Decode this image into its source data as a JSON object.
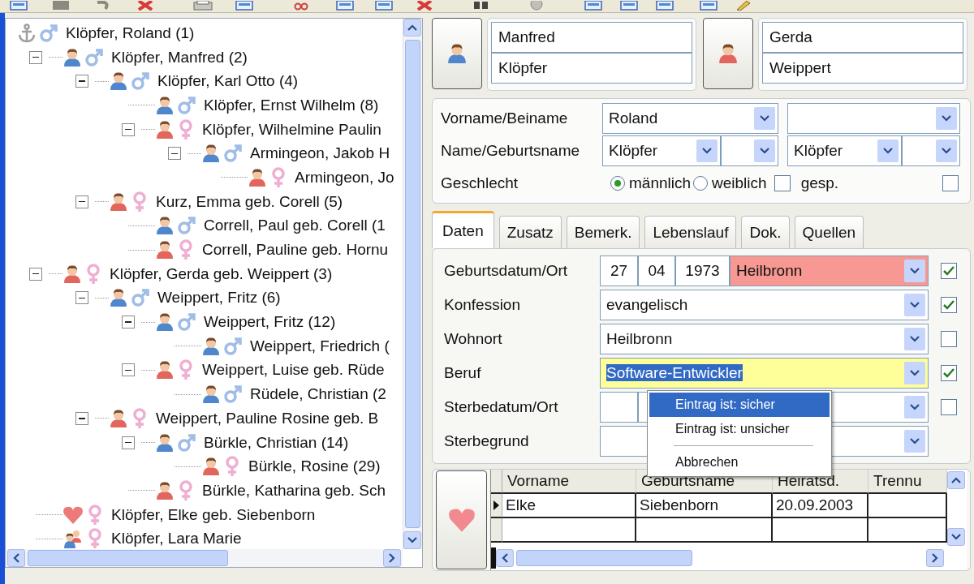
{
  "tree": {
    "nodes": [
      {
        "name": "Klöpfer, Roland (1)",
        "female": false,
        "kind": "anchor",
        "children": [
          {
            "name": "Klöpfer, Manfred (2)",
            "female": false,
            "kind": "person",
            "children": [
              {
                "name": "Klöpfer, Karl Otto (4)",
                "female": false,
                "kind": "person",
                "children": [
                  {
                    "name": "Klöpfer, Ernst Wilhelm (8)",
                    "female": false,
                    "kind": "person"
                  },
                  {
                    "name": "Klöpfer, Wilhelmine Paulin",
                    "female": true,
                    "kind": "person",
                    "children": [
                      {
                        "name": "Armingeon, Jakob H",
                        "female": false,
                        "kind": "person",
                        "children": [
                          {
                            "name": "Armingeon, Jo",
                            "female": true,
                            "kind": "person"
                          }
                        ]
                      }
                    ]
                  }
                ]
              },
              {
                "name": "Kurz, Emma geb. Corell (5)",
                "female": true,
                "kind": "person",
                "children": [
                  {
                    "name": "Correll, Paul geb. Corell (1",
                    "female": false,
                    "kind": "person"
                  },
                  {
                    "name": "Correll, Pauline geb. Hornu",
                    "female": true,
                    "kind": "person"
                  }
                ]
              }
            ]
          },
          {
            "name": "Klöpfer, Gerda geb. Weippert (3)",
            "female": true,
            "kind": "person",
            "children": [
              {
                "name": "Weippert, Fritz (6)",
                "female": false,
                "kind": "person",
                "children": [
                  {
                    "name": "Weippert, Fritz (12)",
                    "female": false,
                    "kind": "person",
                    "children": [
                      {
                        "name": "Weippert, Friedrich (",
                        "female": false,
                        "kind": "person"
                      }
                    ]
                  },
                  {
                    "name": "Weippert, Luise geb. Rüde",
                    "female": true,
                    "kind": "person",
                    "children": [
                      {
                        "name": "Rüdele, Christian (2",
                        "female": false,
                        "kind": "person"
                      }
                    ]
                  }
                ]
              },
              {
                "name": "Weippert, Pauline Rosine geb. B",
                "female": true,
                "kind": "person",
                "children": [
                  {
                    "name": "Bürkle, Christian (14)",
                    "female": false,
                    "kind": "person",
                    "children": [
                      {
                        "name": "Bürkle, Rosine (29)",
                        "female": true,
                        "kind": "person"
                      }
                    ]
                  },
                  {
                    "name": "Bürkle, Katharina geb. Sch",
                    "female": true,
                    "kind": "person"
                  }
                ]
              }
            ]
          },
          {
            "name": "Klöpfer, Elke geb. Siebenborn",
            "female": true,
            "kind": "heart"
          },
          {
            "name": "Klöpfer, Lara Marie",
            "female": true,
            "kind": "child"
          }
        ]
      }
    ]
  },
  "parents": [
    {
      "first": "Manfred",
      "last": "Klöpfer",
      "female": false
    },
    {
      "first": "Gerda",
      "last": "Weippert",
      "female": true
    }
  ],
  "name_fields": {
    "first_name_label": "Vorname/Beiname",
    "first_name": "Roland",
    "last_name_label": "Name/Geburtsname",
    "last_name": "Klöpfer",
    "birth_name": "Klöpfer",
    "sex_label": "Geschlecht",
    "sex_options": [
      {
        "label": "männlich",
        "selected": true
      },
      {
        "label": "weiblich",
        "selected": false
      }
    ],
    "locked": {
      "label": "gesp.",
      "checked": false
    },
    "extra_checked": false
  },
  "tabs": [
    {
      "label": "Daten",
      "selected": true
    },
    {
      "label": "Zusatz",
      "selected": false
    },
    {
      "label": "Bemerk.",
      "selected": false
    },
    {
      "label": "Lebenslauf",
      "selected": false
    },
    {
      "label": "Dok.",
      "selected": false
    },
    {
      "label": "Quellen",
      "selected": false
    }
  ],
  "data_rows": [
    {
      "label": "Geburtsdatum/Ort",
      "kind": "date_place",
      "day": "27",
      "month": "04",
      "year": "1973",
      "place": "Heilbronn",
      "color": "#f79892",
      "checked": true
    },
    {
      "label": "Konfession",
      "kind": "combo",
      "value": "evangelisch",
      "checked": true
    },
    {
      "label": "Wohnort",
      "kind": "combo",
      "value": "Heilbronn",
      "checked": false
    },
    {
      "label": "Beruf",
      "kind": "combo",
      "value": "Software-Entwickler",
      "color": "#ffff99",
      "text_selected": true,
      "checked": true
    },
    {
      "label": "Sterbedatum/Ort",
      "kind": "date_place",
      "checked": false
    },
    {
      "label": "Sterbegrund",
      "kind": "combo"
    }
  ],
  "context_menu": {
    "items": [
      {
        "kind": "item",
        "label": "Eintrag ist: sicher",
        "selected": true
      },
      {
        "kind": "item",
        "label": "Eintrag ist: unsicher",
        "selected": false
      },
      {
        "kind": "separator"
      },
      {
        "kind": "item",
        "label": "Abbrechen",
        "selected": false
      }
    ]
  },
  "partners": {
    "columns": [
      "Vorname",
      "Geburtsname",
      "Heiratsd.",
      "Trennu"
    ],
    "rows": [
      {
        "cells": [
          "Elke",
          "Siebenborn",
          "20.09.2003"
        ],
        "current": true
      }
    ]
  }
}
